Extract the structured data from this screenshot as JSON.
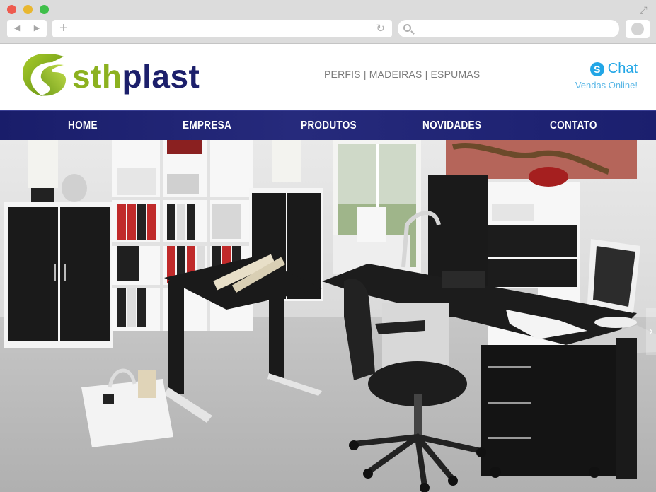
{
  "browser": {
    "back_icon": "back-arrow-icon",
    "forward_icon": "forward-arrow-icon",
    "new_tab_icon": "plus-icon",
    "reload_icon": "reload-icon",
    "search_icon": "search-icon",
    "fullscreen_icon": "expand-icon"
  },
  "header": {
    "logo": {
      "part1": "sth",
      "part2": "plast"
    },
    "tagline": "PERFIS | MADEIRAS | ESPUMAS",
    "chat": {
      "icon": "skype-icon",
      "icon_glyph": "S",
      "label": "Chat",
      "sublabel": "Vendas Online!"
    }
  },
  "nav": {
    "items": [
      {
        "label": "HOME"
      },
      {
        "label": "EMPRESA"
      },
      {
        "label": "PRODUTOS"
      },
      {
        "label": "NOVIDADES"
      },
      {
        "label": "CONTATO"
      }
    ]
  },
  "hero": {
    "next_glyph": "›",
    "colors": {
      "nav_bg": "#1c1f6b",
      "logo_green": "#8cb11f",
      "logo_blue": "#1c1f6b",
      "chat_blue": "#22a6e6"
    }
  }
}
